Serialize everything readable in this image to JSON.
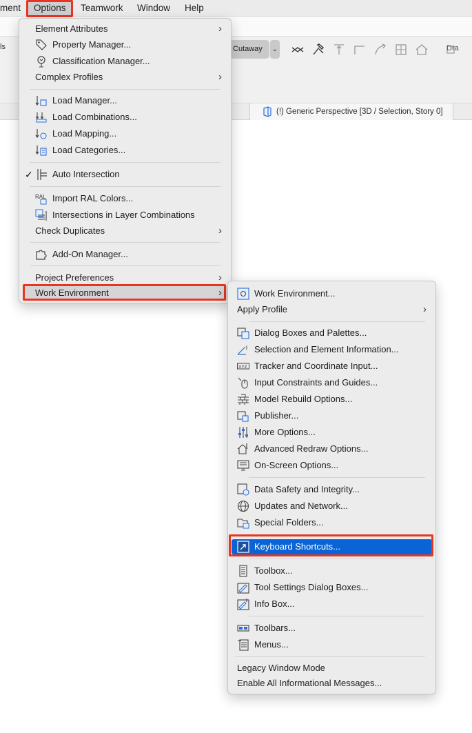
{
  "menubar": {
    "items": [
      "ment",
      "Options",
      "Teamwork",
      "Window",
      "Help"
    ]
  },
  "app": {
    "toolbar_left_label": "ls",
    "cutaway_label": "Cutaway",
    "draw_label": "Dra",
    "view_tab_label": "(!) Generic Perspective [3D / Selection, Story 0]"
  },
  "options_menu": {
    "element_attributes": "Element Attributes",
    "property_manager": "Property Manager...",
    "classification_manager": "Classification Manager...",
    "complex_profiles": "Complex Profiles",
    "load_manager": "Load Manager...",
    "load_combinations": "Load Combinations...",
    "load_mapping": "Load Mapping...",
    "load_categories": "Load Categories...",
    "auto_intersection": "Auto Intersection",
    "auto_intersection_checked": true,
    "import_ral_colors": "Import RAL Colors...",
    "intersections_layer_combinations": "Intersections in Layer Combinations",
    "check_duplicates": "Check Duplicates",
    "addon_manager": "Add-On Manager...",
    "project_preferences": "Project Preferences",
    "work_environment": "Work Environment"
  },
  "work_env_menu": {
    "work_environment": "Work Environment...",
    "apply_profile": "Apply Profile",
    "dialog_boxes_palettes": "Dialog Boxes and Palettes...",
    "selection_element_info": "Selection and Element Information...",
    "tracker_coordinate_input": "Tracker and Coordinate Input...",
    "input_constraints_guides": "Input Constraints and Guides...",
    "model_rebuild_options": "Model Rebuild Options...",
    "publisher": "Publisher...",
    "more_options": "More Options...",
    "advanced_redraw_options": "Advanced Redraw Options...",
    "onscreen_options": "On-Screen Options...",
    "data_safety_integrity": "Data Safety and Integrity...",
    "updates_network": "Updates and Network...",
    "special_folders": "Special Folders...",
    "keyboard_shortcuts": "Keyboard Shortcuts...",
    "toolbox": "Toolbox...",
    "tool_settings_dialog_boxes": "Tool Settings Dialog Boxes...",
    "info_box": "Info Box...",
    "toolbars": "Toolbars...",
    "menus": "Menus...",
    "legacy_window_mode": "Legacy Window Mode",
    "enable_informational_messages": "Enable All Informational Messages..."
  },
  "colors": {
    "selection_blue": "#0a64d6",
    "highlight_red": "#e8351f"
  }
}
